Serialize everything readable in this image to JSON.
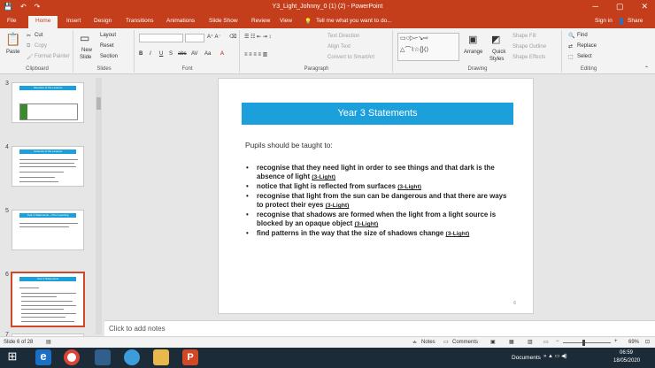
{
  "window": {
    "title": "Y3_Light_Johnny_0 (1) (2)  -  PowerPoint",
    "min_glyph": "─",
    "restore_glyph": "▢",
    "close_glyph": "✕"
  },
  "qat": {
    "save_glyph": "💾",
    "undo_glyph": "↶",
    "redo_glyph": "↷"
  },
  "tabs": [
    "File",
    "Home",
    "Insert",
    "Design",
    "Transitions",
    "Animations",
    "Slide Show",
    "Review",
    "View"
  ],
  "tell_me": "Tell me what you want to do...",
  "account": {
    "signin": "Sign in",
    "share": "Share"
  },
  "ribbon": {
    "clipboard": {
      "paste": "Paste",
      "cut": "Cut",
      "copy": "Copy",
      "format_painter": "Format Painter",
      "label": "Clipboard"
    },
    "slides": {
      "new_slide": "New",
      "new_slide2": "Slide",
      "layout": "Layout",
      "reset": "Reset",
      "section": "Section",
      "label": "Slides"
    },
    "font": {
      "label": "Font",
      "buttons": [
        "B",
        "I",
        "U",
        "S",
        "abc",
        "AV",
        "Aa",
        "A"
      ]
    },
    "paragraph": {
      "text_direction": "Text Direction",
      "align_text": "Align Text",
      "convert_smartart": "Convert to SmartArt",
      "label": "Paragraph"
    },
    "drawing": {
      "arrange": "Arrange",
      "quick_styles": "Quick",
      "quick_styles2": "Styles",
      "shape_fill": "Shape Fill",
      "shape_outline": "Shape Outline",
      "shape_effects": "Shape Effects",
      "label": "Drawing"
    },
    "editing": {
      "find": "Find",
      "replace": "Replace",
      "select": "Select",
      "label": "Editing"
    }
  },
  "thumbnails": [
    {
      "number": "3",
      "title": "Structure of the Lessons"
    },
    {
      "number": "4",
      "title": "Contents of the Lessons"
    },
    {
      "number": "5",
      "title": "Year 3 Statements – Prior Learning"
    },
    {
      "number": "6",
      "title": "Year 3 Statements"
    },
    {
      "number": "7"
    }
  ],
  "slide": {
    "title": "Year 3 Statements",
    "intro": "Pupils should be taught to:",
    "bullets": [
      {
        "text": "recognise that they need light in order to see things and that dark is the absence of light",
        "link": "(3-Light)"
      },
      {
        "text": "notice that light is reflected from surfaces",
        "link": "(3-Light)"
      },
      {
        "text": "recognise that light from the sun can be dangerous and that there are ways to protect their eyes",
        "link": "(3-Light)"
      },
      {
        "text": "recognise that shadows are formed when the light from a light source is blocked by an opaque object",
        "link": "(3-Light)"
      },
      {
        "text": "find patterns in the way that the size of shadows change",
        "link": "(3-Light)"
      }
    ],
    "number": "6",
    "bullet_glyph": "•"
  },
  "notes_placeholder": "Click to add notes",
  "status": {
    "slide_info": "Slide 6 of 28",
    "notes": "Notes",
    "comments": "Comments",
    "zoom": "69%"
  },
  "taskbar": {
    "documents": "Documents",
    "time": "06:59",
    "date": "18/05/2020"
  },
  "colors": {
    "accent": "#c43e1c",
    "slide_band": "#1ca0db",
    "selected_thumb": "#d24726"
  }
}
